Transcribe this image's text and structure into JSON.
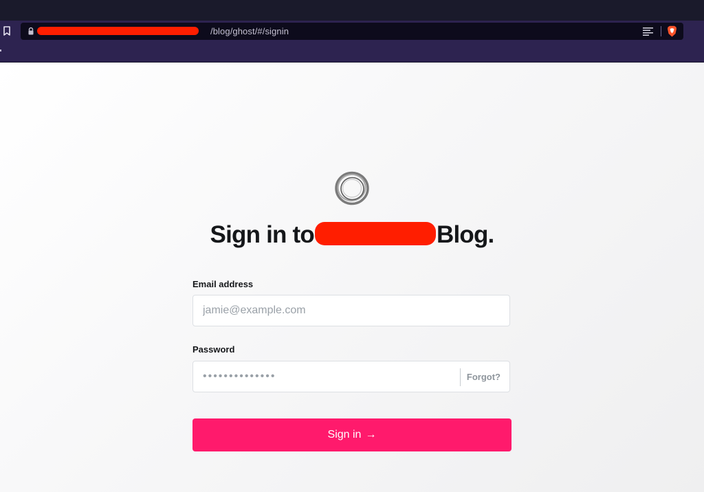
{
  "browser": {
    "url_visible": "/blog/ghost/#/signin",
    "icons": {
      "bookmark": "bookmark-icon",
      "lock": "lock-icon",
      "reader": "reader-mode-icon",
      "brave": "brave-shields-icon"
    }
  },
  "signin": {
    "logo_icon": "site-logo",
    "title_prefix": "Sign in to",
    "title_suffix": "Blog.",
    "email_label": "Email address",
    "email_placeholder": "jamie@example.com",
    "password_label": "Password",
    "password_value": "••••••••••••••",
    "forgot_label": "Forgot?",
    "submit_label": "Sign in",
    "submit_arrow": "→"
  },
  "colors": {
    "accent": "#ff1a6c",
    "redaction": "#ff1e00",
    "toolbar": "#2d2350",
    "tabstrip": "#1a1a2b"
  }
}
